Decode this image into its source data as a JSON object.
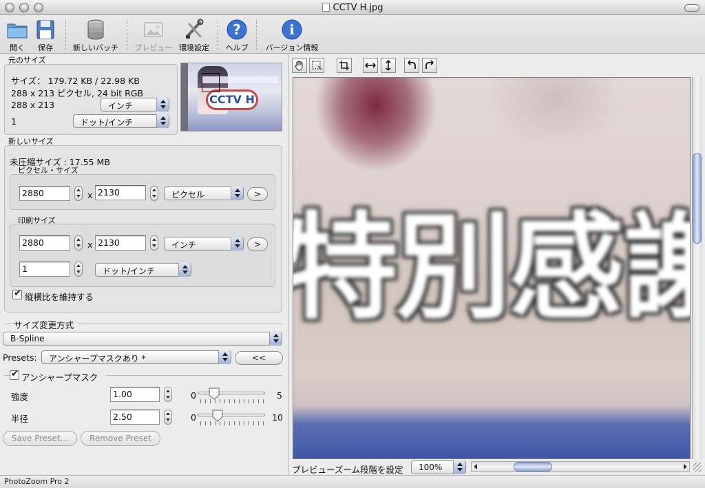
{
  "window": {
    "title": "CCTV H.jpg"
  },
  "toolbar": {
    "open": "開く",
    "save": "保存",
    "new_batch": "新しいバッチ",
    "preview": "プレビュー",
    "preferences": "環境設定",
    "help": "ヘルプ",
    "version_info": "バージョン情報"
  },
  "original": {
    "section_label": "元のサイズ",
    "size_line": "サイズ： 179.72 KB / 22.98 KB",
    "pixels_line": "288 x 213 ピクセル, 24 bit RGB",
    "dims_value": "288 x 213",
    "dims_unit": "インチ",
    "resolution_value": "1",
    "resolution_unit": "ドット/インチ"
  },
  "new_size": {
    "section_label": "新しいサイズ",
    "uncompressed": "未圧縮サイズ : 17.55 MB",
    "pixel_size_label": "ピクセル・サイズ",
    "pixel_width": "2880",
    "pixel_height": "2130",
    "pixel_unit": "ピクセル",
    "times": "x",
    "arrow_button": ">",
    "print_size_label": "印刷サイズ",
    "print_width": "2880",
    "print_height": "2130",
    "print_unit": "インチ",
    "print_resolution": "1",
    "print_resolution_unit": "ドット/インチ",
    "keep_ratio": "縦横比を維持する"
  },
  "resize": {
    "section_label": "サイズ変更方式",
    "method": "B-Spline",
    "presets_label": "Presets:",
    "preset_value": "アンシャープマスクあり *",
    "preset_button": "<<"
  },
  "unsharp": {
    "section_label": "アンシャープマスク",
    "strength_label": "強度",
    "strength_value": "1.00",
    "strength_min": "0",
    "strength_max": "5",
    "strength_level": 0.2,
    "radius_label": "半径",
    "radius_value": "2.50",
    "radius_min": "0",
    "radius_max": "10",
    "radius_level": 0.25,
    "save_preset": "Save Preset...",
    "remove_preset": "Remove Preset"
  },
  "thumbnail": {
    "badge_text": "CCTV H"
  },
  "preview": {
    "visible_text": "特別感謝",
    "zoom_label": "プレビューズーム段階を設定",
    "zoom_value": "100%"
  },
  "status": {
    "app_name": "PhotoZoom Pro 2"
  }
}
